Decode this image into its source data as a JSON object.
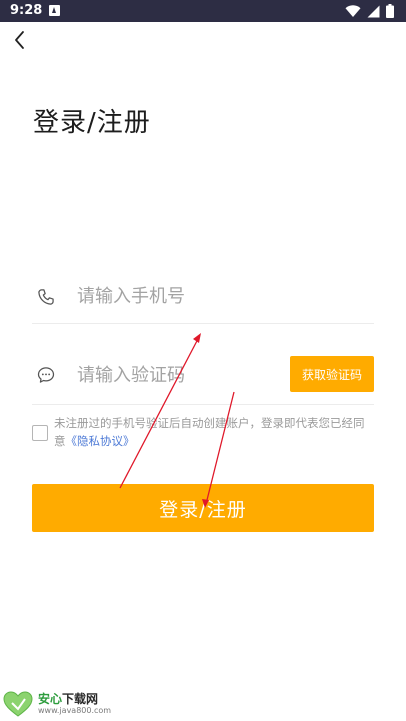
{
  "status_bar": {
    "time": "9:28"
  },
  "header": {
    "title": "登录/注册"
  },
  "form": {
    "phone_placeholder": "请输入手机号",
    "code_placeholder": "请输入验证码",
    "get_code_label": "获取验证码",
    "agreement_text": "未注册过的手机号验证后自动创建账户，登录即代表您已经同意",
    "privacy_link": "《隐私协议》",
    "submit_label": "登录/注册"
  },
  "watermark": {
    "brand_a": "安心",
    "brand_b": "下载网",
    "url": "www.java800.com",
    "logo_text": "安心下载"
  },
  "icons": {
    "back": "chevron-left-icon",
    "phone": "phone-icon",
    "chat": "chat-bubble-icon",
    "wifi": "wifi-icon",
    "signal": "signal-icon",
    "battery": "battery-icon",
    "notification": "notification-icon"
  },
  "colors": {
    "accent": "#ffab00",
    "status_bar": "#2d2d44",
    "link": "#4d7ad6",
    "annotation": "#e0182a"
  }
}
